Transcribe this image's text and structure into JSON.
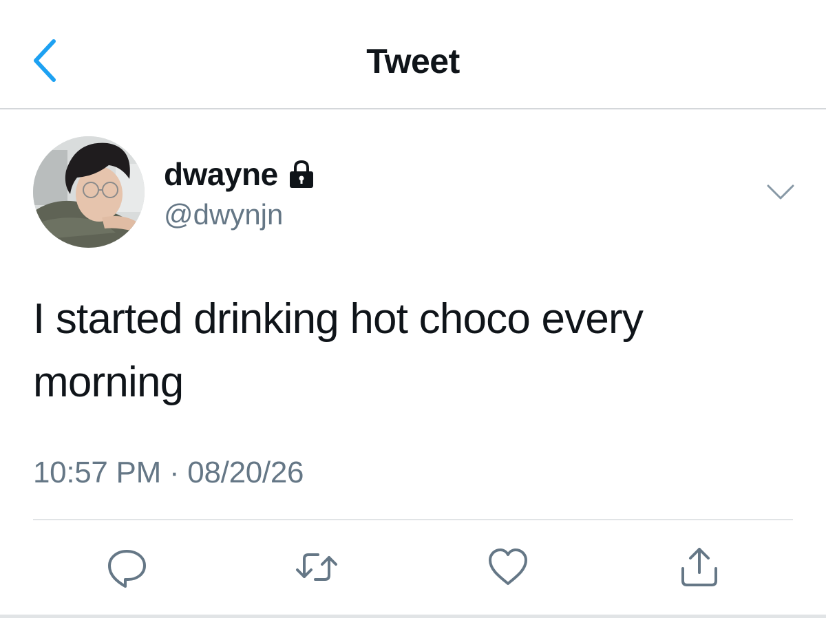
{
  "header": {
    "title": "Tweet",
    "back_icon": "chevron-left-icon"
  },
  "author": {
    "display_name": "dwayne",
    "handle": "@dwynjn",
    "protected_icon": "lock-icon",
    "avatar_description": "profile photo"
  },
  "tweet": {
    "text": "I started drinking hot choco every morning",
    "time": "10:57 PM",
    "separator": "·",
    "date": "08/20/26"
  },
  "actions": [
    {
      "name": "reply",
      "icon": "reply-icon"
    },
    {
      "name": "retweet",
      "icon": "retweet-icon"
    },
    {
      "name": "like",
      "icon": "heart-icon"
    },
    {
      "name": "share",
      "icon": "share-icon"
    }
  ],
  "colors": {
    "accent": "#1da1f2",
    "text": "#0f1419",
    "secondary": "#657786",
    "icon": "#657786",
    "divider": "#e1e4e6"
  }
}
